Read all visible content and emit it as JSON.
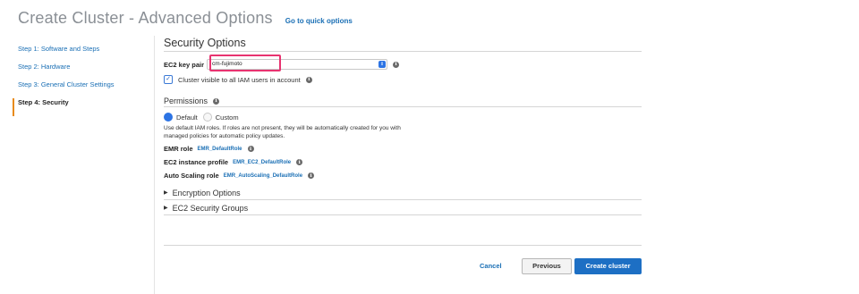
{
  "header": {
    "title": "Create Cluster - Advanced Options",
    "quick_link": "Go to quick options"
  },
  "steps": [
    {
      "label": "Step 1: Software and Steps"
    },
    {
      "label": "Step 2: Hardware"
    },
    {
      "label": "Step 3: General Cluster Settings"
    },
    {
      "label": "Step 4: Security",
      "active": true
    }
  ],
  "security": {
    "title": "Security Options",
    "key_pair_label": "EC2 key pair",
    "key_pair_value": "cm-fujimoto",
    "visible_label": "Cluster visible to all IAM users in account",
    "visible_checked": true
  },
  "permissions": {
    "title": "Permissions",
    "default_label": "Default",
    "custom_label": "Custom",
    "description": "Use default IAM roles. If roles are not present, they will be automatically created for you with managed policies for automatic policy updates.",
    "emr_role_label": "EMR role",
    "emr_role_value": "EMR_DefaultRole",
    "ec2_profile_label": "EC2 instance profile",
    "ec2_profile_value": "EMR_EC2_DefaultRole",
    "autoscaling_label": "Auto Scaling role",
    "autoscaling_value": "EMR_AutoScaling_DefaultRole"
  },
  "expanders": {
    "encryption": "Encryption Options",
    "security_groups": "EC2 Security Groups"
  },
  "footer": {
    "cancel": "Cancel",
    "previous": "Previous",
    "create": "Create cluster"
  },
  "icons": {
    "info": "info-icon",
    "dropdown": "dropdown-arrow-icon",
    "check": "checkmark-icon",
    "expand": "triangle-right-icon"
  },
  "colors": {
    "link": "#1a6fb5",
    "primary_button": "#1d6fc4",
    "highlight": "#e83370",
    "active_step_marker": "#e88b1b"
  }
}
